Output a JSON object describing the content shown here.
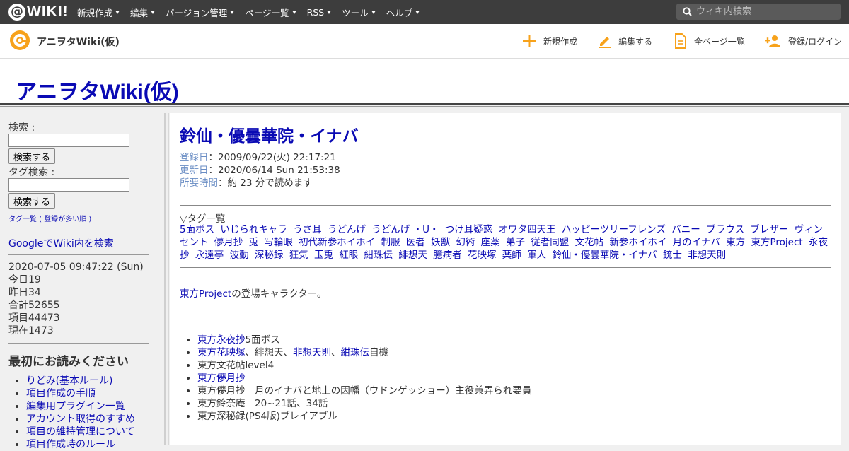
{
  "topbar": {
    "logo_text": "WIKI!",
    "logo_mark": "@",
    "menu": [
      "新規作成",
      "編集",
      "バージョン管理",
      "ページ一覧",
      "RSS",
      "ツール",
      "ヘルプ"
    ],
    "search_placeholder": "ウィキ内検索"
  },
  "header": {
    "site_name": "アニヲタWiki(仮)",
    "nav": [
      "新規作成",
      "編集する",
      "全ページ一覧",
      "登録/ログイン"
    ]
  },
  "banner": {
    "title": "アニヲタWiki(仮)"
  },
  "sidebar": {
    "search_label": "検索 :",
    "search_button": "検索する",
    "tag_search_label": "タグ検索 :",
    "tag_search_button": "検索する",
    "tag_list_link": "タグ一覧 ( 登録が多い順 )",
    "google_link": "GoogleでWiki内を検索",
    "counter": {
      "datetime": "2020-07-05 09:47:22 (Sun)",
      "today": "今日19",
      "yesterday": "昨日34",
      "total": "合計52655",
      "items": "項目44473",
      "current": "現在1473"
    },
    "read_first_heading": "最初にお読みください",
    "read_first_items": [
      "りどみ(基本ルール)",
      "項目作成の手順",
      "編集用プラグイン一覧",
      "アカウント取得のすすめ",
      "項目の維持管理について",
      "項目作成時のルール"
    ]
  },
  "page": {
    "title": "鈴仙・優曇華院・イナバ",
    "registered_label": "登録日",
    "registered": "：2009/09/22(火) 22:17:21",
    "updated_label": "更新日",
    "updated": "：2020/06/14 Sun 21:53:38",
    "read_time_label": "所要時間",
    "read_time": "：約 23 分で読めます",
    "tags_heading": "▽タグ一覧",
    "tags": [
      "5面ボス",
      "いじられキャラ",
      "うさ耳",
      "うどんげ",
      "うどんげ ・U・",
      "つけ耳疑惑",
      "オワタ四天王",
      "ハッピーツリーフレンズ",
      "バニー",
      "ブラウス",
      "ブレザー",
      "ヴィンセント",
      "儚月抄",
      "兎",
      "写輪眼",
      "初代新参ホイホイ",
      "制服",
      "医者",
      "妖獣",
      "幻術",
      "座薬",
      "弟子",
      "従者同盟",
      "文花帖",
      "新参ホイホイ",
      "月のイナバ",
      "東方",
      "東方Project",
      "永夜抄",
      "永遠亭",
      "波動",
      "深秘録",
      "狂気",
      "玉兎",
      "紅眼",
      "紺珠伝",
      "緋想天",
      "臆病者",
      "花映塚",
      "薬師",
      "軍人",
      "鈴仙・優曇華院・イナバ",
      "銃士",
      "非想天則"
    ],
    "intro_link": "東方Project",
    "intro_rest": "の登場キャラクター。",
    "works": [
      {
        "link": "東方永夜抄",
        "rest": "5面ボス"
      },
      {
        "link": "東方花映塚",
        "mid": "、緋想天、",
        "link2": "非想天則",
        "sep": "、",
        "link3": "紺珠伝",
        "rest": "自機"
      },
      {
        "text": "東方文花帖level4"
      },
      {
        "link": "東方儚月抄",
        "rest": ""
      },
      {
        "text": "東方儚月抄　月のイナバと地上の因幡（ウドンゲッショー）主役兼弄られ要員"
      },
      {
        "text": "東方鈴奈庵　20~21話、34話"
      },
      {
        "text": "東方深秘録(PS4版)プレイアブル"
      }
    ]
  }
}
